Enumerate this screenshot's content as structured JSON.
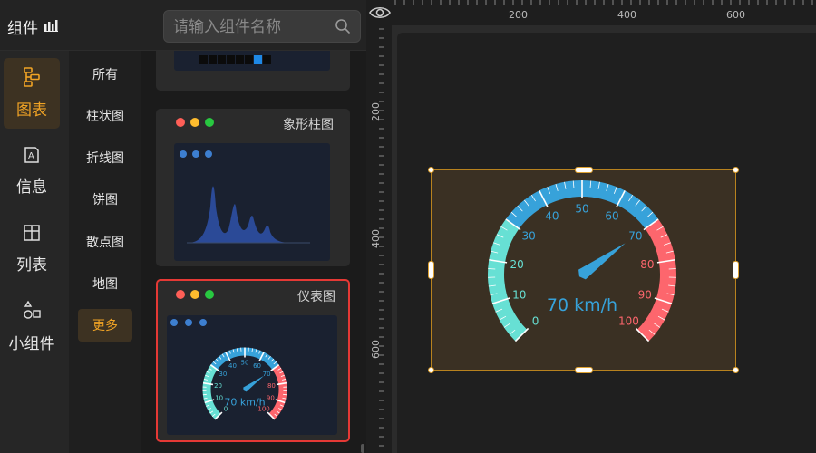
{
  "panel": {
    "title": "组件",
    "search_placeholder": "请输入组件名称"
  },
  "categories": [
    {
      "label": "图表",
      "icon": "chart-nodes-icon",
      "active": true
    },
    {
      "label": "信息",
      "icon": "text-image-icon",
      "active": false
    },
    {
      "label": "列表",
      "icon": "grid-table-icon",
      "active": false
    },
    {
      "label": "小组件",
      "icon": "widget-shapes-icon",
      "active": false
    }
  ],
  "sub_categories": [
    {
      "label": "所有",
      "active": false
    },
    {
      "label": "柱状图",
      "active": false
    },
    {
      "label": "折线图",
      "active": false
    },
    {
      "label": "饼图",
      "active": false
    },
    {
      "label": "散点图",
      "active": false
    },
    {
      "label": "地图",
      "active": false
    },
    {
      "label": "更多",
      "active": true
    }
  ],
  "cards": [
    {
      "title": "象形柱图"
    },
    {
      "title": "仪表图",
      "selected": true
    }
  ],
  "ruler": {
    "top_labels": [
      "200",
      "400",
      "600"
    ],
    "left_labels": [
      "200",
      "400",
      "600"
    ]
  },
  "gauge": {
    "ticks": [
      "0",
      "10",
      "20",
      "30",
      "40",
      "50",
      "60",
      "70",
      "80",
      "90",
      "100"
    ],
    "detail_text": "70 km/h",
    "value": 70,
    "min": 0,
    "max": 100,
    "colors": {
      "low": "#67e0d4",
      "mid": "#37a2da",
      "high": "#fd666d"
    }
  },
  "colors": {
    "accent": "#f0a325",
    "window_dots": [
      "#ff5f57",
      "#febc2e",
      "#28c840"
    ],
    "selection_border": "#e53935"
  }
}
